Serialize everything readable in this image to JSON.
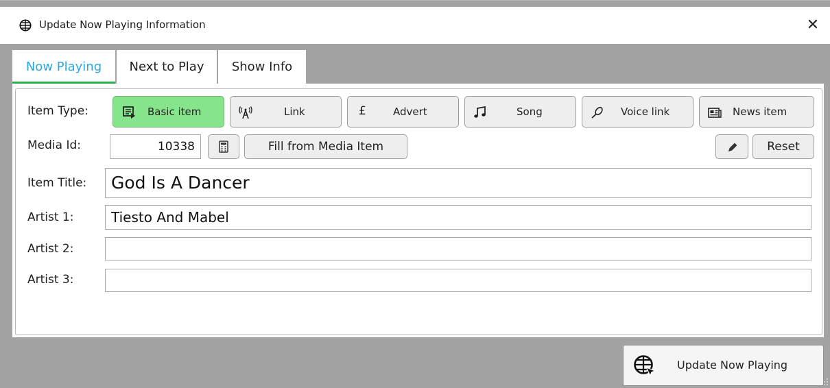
{
  "window": {
    "title": "Update Now Playing Information",
    "close_glyph": "✕"
  },
  "tabs": [
    {
      "label": "Now Playing",
      "active": true
    },
    {
      "label": "Next to Play",
      "active": false
    },
    {
      "label": "Show Info",
      "active": false
    }
  ],
  "labels": {
    "item_type": "Item Type:",
    "media_id": "Media Id:",
    "item_title": "Item Title:",
    "artist1": "Artist 1:",
    "artist2": "Artist 2:",
    "artist3": "Artist 3:"
  },
  "item_types": [
    {
      "label": "Basic item",
      "icon": "basic-item-icon",
      "selected": true
    },
    {
      "label": "Link",
      "icon": "antenna-icon",
      "selected": false
    },
    {
      "label": "Advert",
      "icon": "pound-icon",
      "selected": false
    },
    {
      "label": "Song",
      "icon": "music-note-icon",
      "selected": false
    },
    {
      "label": "Voice link",
      "icon": "microphone-icon",
      "selected": false
    },
    {
      "label": "News item",
      "icon": "newspaper-icon",
      "selected": false
    }
  ],
  "media": {
    "id_value": "10338",
    "fill_label": "Fill from Media Item",
    "reset_label": "Reset",
    "calculator_icon": "calculator-icon",
    "edit_icon": "pencil-icon"
  },
  "fields": {
    "item_title": "God Is A Dancer",
    "artist1": "Tiesto And Mabel",
    "artist2": "",
    "artist3": ""
  },
  "footer": {
    "update_label": "Update Now Playing",
    "icon": "globe-cursor-icon"
  },
  "colors": {
    "selected_type": "#86e58a",
    "active_tab": "#28a8e0",
    "tab_underline": "#2eaf4e",
    "background": "#a3a3a3"
  }
}
